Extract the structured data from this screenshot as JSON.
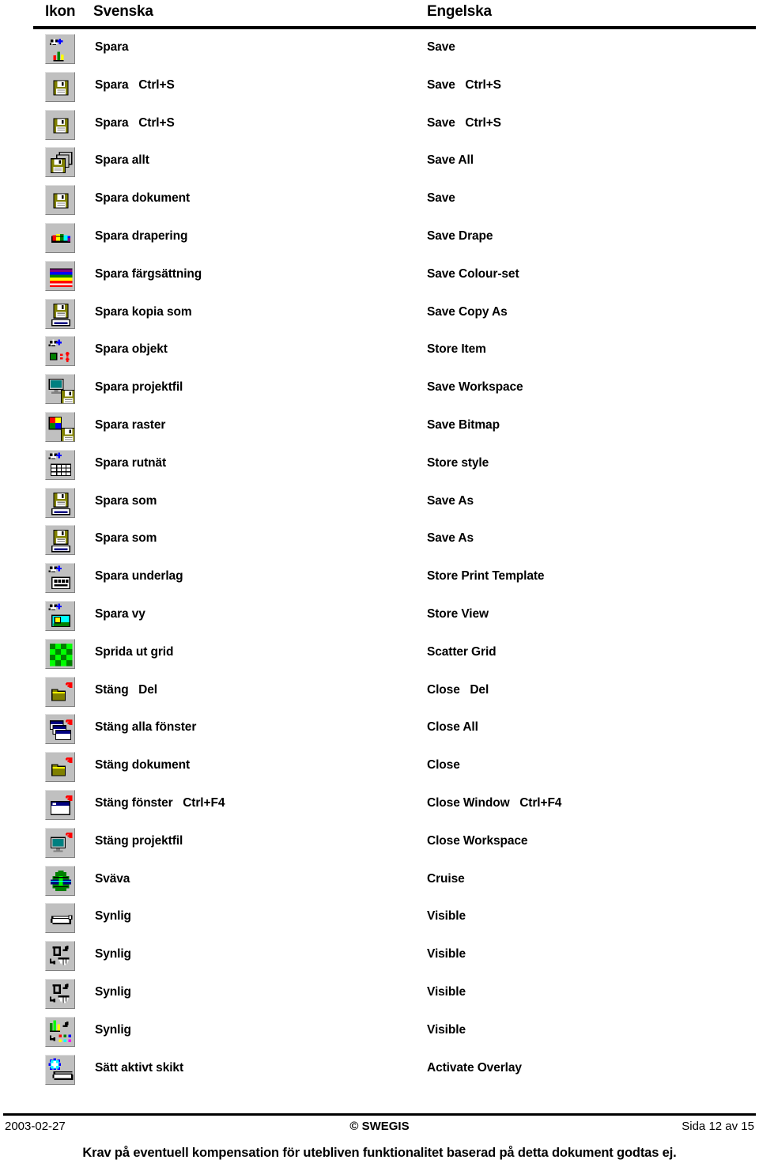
{
  "header": {
    "col_icon": "Ikon",
    "col_swedish": "Svenska",
    "col_english": "Engelska"
  },
  "rows": [
    {
      "icon": "save-chart-plus-icon",
      "swedish": "Spara",
      "english": "Save"
    },
    {
      "icon": "floppy-disk-icon",
      "swedish": "Spara   Ctrl+S",
      "english": "Save   Ctrl+S"
    },
    {
      "icon": "floppy-disk-icon",
      "swedish": "Spara   Ctrl+S",
      "english": "Save   Ctrl+S"
    },
    {
      "icon": "save-all-floppies-icon",
      "swedish": "Spara allt",
      "english": "Save All"
    },
    {
      "icon": "save-document-floppy-icon",
      "swedish": "Spara dokument",
      "english": "Save"
    },
    {
      "icon": "save-drape-icon",
      "swedish": "Spara drapering",
      "english": "Save Drape"
    },
    {
      "icon": "save-colourset-icon",
      "swedish": "Spara färgsättning",
      "english": "Save Colour-set"
    },
    {
      "icon": "save-copy-as-icon",
      "swedish": "Spara kopia som",
      "english": "Save Copy As"
    },
    {
      "icon": "store-item-icon",
      "swedish": "Spara objekt",
      "english": "Store Item"
    },
    {
      "icon": "save-workspace-icon",
      "swedish": "Spara projektfil",
      "english": "Save Workspace"
    },
    {
      "icon": "save-bitmap-icon",
      "swedish": "Spara raster",
      "english": "Save Bitmap"
    },
    {
      "icon": "store-style-grid-icon",
      "swedish": "Spara rutnät",
      "english": "Store style"
    },
    {
      "icon": "save-as-floppy-icon",
      "swedish": "Spara som",
      "english": "Save As"
    },
    {
      "icon": "save-as-floppy-icon",
      "swedish": "Spara som",
      "english": "Save As"
    },
    {
      "icon": "store-print-template-icon",
      "swedish": "Spara underlag",
      "english": "Store Print Template"
    },
    {
      "icon": "store-view-icon",
      "swedish": "Spara vy",
      "english": "Store View"
    },
    {
      "icon": "scatter-grid-icon",
      "swedish": "Sprida ut grid",
      "english": "Scatter Grid"
    },
    {
      "icon": "close-folder-icon",
      "swedish": "Stäng   Del",
      "english": "Close   Del"
    },
    {
      "icon": "close-all-windows-icon",
      "swedish": "Stäng alla fönster",
      "english": "Close All"
    },
    {
      "icon": "close-document-folder-icon",
      "swedish": "Stäng dokument",
      "english": "Close"
    },
    {
      "icon": "close-window-icon",
      "swedish": "Stäng fönster   Ctrl+F4",
      "english": "Close Window   Ctrl+F4"
    },
    {
      "icon": "close-workspace-icon",
      "swedish": "Stäng projektfil",
      "english": "Close Workspace"
    },
    {
      "icon": "cruise-globe-icon",
      "swedish": "Sväva",
      "english": "Cruise"
    },
    {
      "icon": "visible-slab-icon",
      "swedish": "Synlig",
      "english": "Visible"
    },
    {
      "icon": "visible-object-icon",
      "swedish": "Synlig",
      "english": "Visible"
    },
    {
      "icon": "visible-object-icon",
      "swedish": "Synlig",
      "english": "Visible"
    },
    {
      "icon": "visible-chart-icon",
      "swedish": "Synlig",
      "english": "Visible"
    },
    {
      "icon": "activate-overlay-icon",
      "swedish": "Sätt aktivt skikt",
      "english": "Activate Overlay"
    }
  ],
  "footer": {
    "date": "2003-02-27",
    "copyright": "© SWEGIS",
    "page": "Sida 12 av 15",
    "disclaimer": "Krav på eventuell kompensation för utebliven funktionalitet baserad på detta dokument godtas ej."
  },
  "colors": {
    "button_face": "#c0c0c0",
    "text": "#000000",
    "background": "#ffffff"
  }
}
